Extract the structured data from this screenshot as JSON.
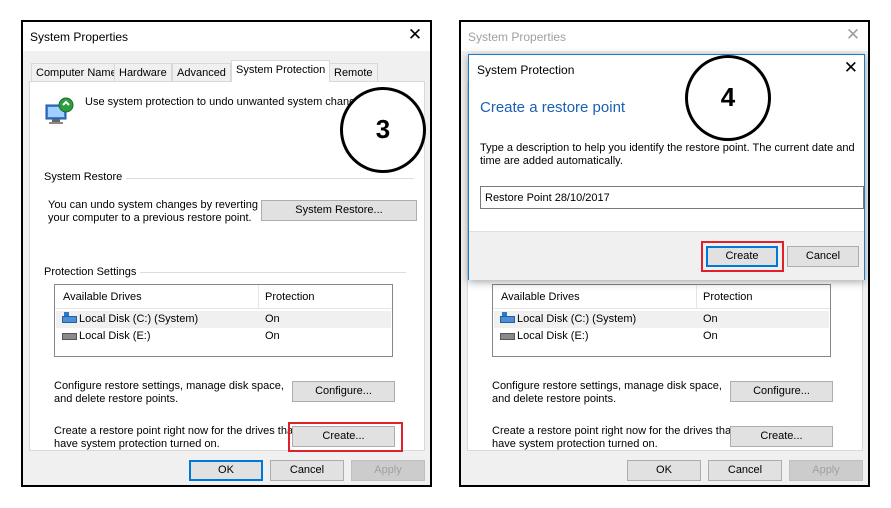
{
  "left_panel": {
    "window_title": "System Properties",
    "close_glyph": "✕",
    "tabs": [
      {
        "label": "Computer Name"
      },
      {
        "label": "Hardware"
      },
      {
        "label": "Advanced"
      },
      {
        "label": "System Protection"
      },
      {
        "label": "Remote"
      }
    ],
    "intro_text": "Use system protection to undo unwanted system changes.",
    "system_restore": {
      "group_label": "System Restore",
      "description_line1": "You can undo system changes by reverting",
      "description_line2": "your computer to a previous restore point.",
      "button_label": "System Restore..."
    },
    "protection_settings": {
      "group_label": "Protection Settings",
      "column_drives": "Available Drives",
      "column_protection": "Protection",
      "drives": [
        {
          "name": "Local Disk (C:) (System)",
          "protection": "On",
          "icon": "system-drive-icon"
        },
        {
          "name": "Local Disk (E:)",
          "protection": "On",
          "icon": "drive-icon"
        }
      ]
    },
    "configure": {
      "description_line1": "Configure restore settings, manage disk space,",
      "description_line2": "and delete restore points.",
      "button_label": "Configure..."
    },
    "create": {
      "description_line1": "Create a restore point right now for the drives that",
      "description_line2": "have system protection turned on.",
      "button_label": "Create..."
    },
    "footer": {
      "ok_label": "OK",
      "cancel_label": "Cancel",
      "apply_label": "Apply"
    }
  },
  "right_panel": {
    "window_title": "System Properties",
    "close_glyph": "✕",
    "drives_header_fragment": "Available Drives",
    "protection_header_fragment": "Protection",
    "drives": [
      {
        "name": "Local Disk (C:) (System)",
        "protection": "On"
      },
      {
        "name": "Local Disk (E:)",
        "protection": "On"
      }
    ],
    "configure": {
      "description_line1": "Configure restore settings, manage disk space,",
      "description_line2": "and delete restore points.",
      "button_label": "Configure..."
    },
    "create": {
      "description_line1": "Create a restore point right now for the drives that",
      "description_line2": "have system protection turned on.",
      "button_label": "Create..."
    },
    "footer": {
      "ok_label": "OK",
      "cancel_label": "Cancel",
      "apply_label": "Apply"
    }
  },
  "dialog": {
    "title": "System Protection",
    "close_glyph": "✕",
    "heading": "Create a restore point",
    "description_line1": "Type a description to help you identify the restore point. The current date and",
    "description_line2": "time are added automatically.",
    "input_value": "Restore Point 28/10/2017",
    "create_label": "Create",
    "cancel_label": "Cancel"
  },
  "callouts": {
    "step_left": "3",
    "step_right": "4"
  },
  "colors": {
    "highlight_red": "#e0202a",
    "heading_blue": "#1a5fb4",
    "focus_blue": "#0078d7"
  }
}
